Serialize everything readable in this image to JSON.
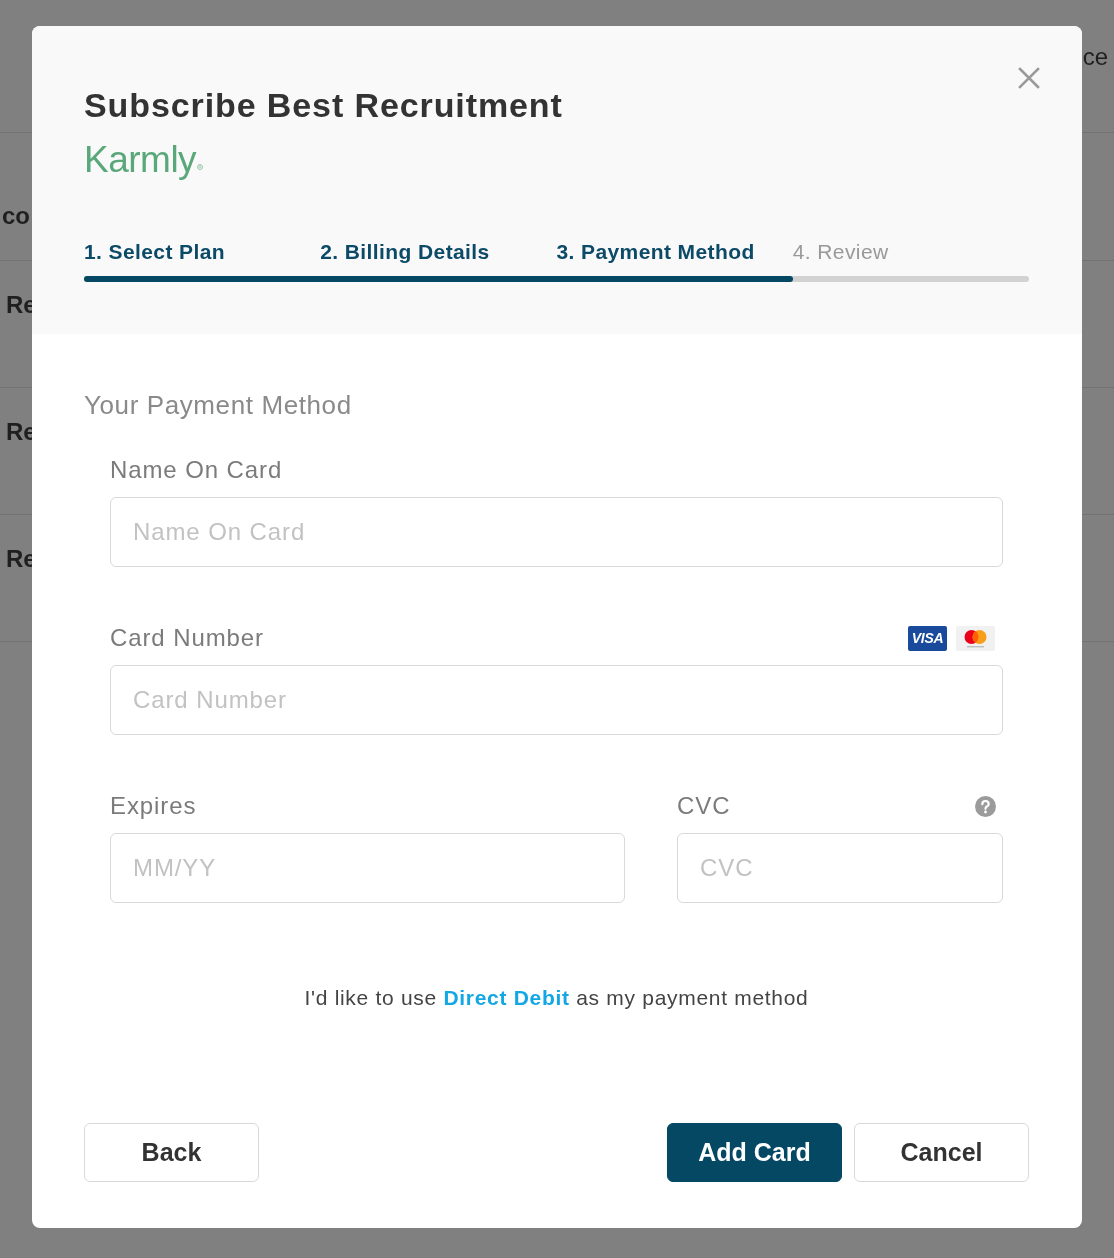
{
  "backdrop": {
    "header_text": "ce",
    "column_heading": "co",
    "rows": [
      "Re",
      "Re",
      "Re"
    ]
  },
  "dialog": {
    "title": "Subscribe Best Recruitment",
    "brand": "Karmly",
    "steps": [
      {
        "label": "1. Select Plan",
        "reached": true
      },
      {
        "label": "2. Billing Details",
        "reached": true
      },
      {
        "label": "3. Payment Method",
        "reached": true
      },
      {
        "label": "4. Review",
        "reached": false
      }
    ],
    "progress": {
      "level": 0.75
    },
    "form": {
      "heading": "Your Payment Method",
      "rows": [
        [
          {
            "kind": "plain",
            "label": "Name On Card",
            "placeholder": "Name On Card"
          }
        ],
        [
          {
            "kind": "card",
            "label": "Card Number",
            "placeholder": "Card Number",
            "logo_text": "VISA"
          }
        ],
        [
          {
            "kind": "plain",
            "label": "Expires",
            "placeholder": "MM/YY"
          },
          {
            "kind": "cvc",
            "label": "CVC",
            "placeholder": "CVC"
          }
        ]
      ]
    },
    "alternative": {
      "before": "I'd like to use",
      "link": "Direct Debit",
      "after": "as my payment method"
    },
    "left_buttons": [
      {
        "label": "Back",
        "primary": false
      }
    ],
    "right_buttons": [
      {
        "label": "Add Card",
        "primary": true
      },
      {
        "label": "Cancel",
        "primary": false
      }
    ]
  }
}
